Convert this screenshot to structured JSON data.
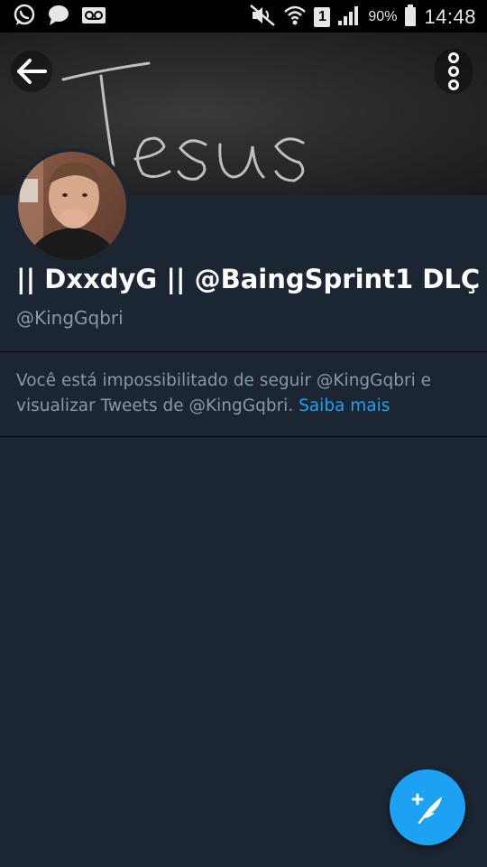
{
  "status_bar": {
    "battery_percent": "90%",
    "time": "14:48",
    "sim_slot": "1",
    "left_icons": [
      "whatsapp-icon",
      "message-icon",
      "voicemail-icon"
    ],
    "right_icons": [
      "mute-icon",
      "wifi-icon",
      "sim-icon",
      "signal-icon",
      "battery-icon"
    ]
  },
  "banner": {
    "chalk_text": "Jesus"
  },
  "profile": {
    "display_name": "|| DxxdyG || @BaingSprint1 DLÇ",
    "handle": "@KingGqbri"
  },
  "notice": {
    "message": "Você está impossibilitado de seguir @KingGqbri e visualizar Tweets de @KingGqbri.",
    "link_label": "Saiba mais"
  },
  "colors": {
    "background": "#1c2633",
    "accent": "#1da1f2",
    "secondary_text": "#8899a6"
  },
  "icons": {
    "back": "back-arrow-icon",
    "more": "more-vertical-icon",
    "compose": "compose-tweet-icon"
  }
}
